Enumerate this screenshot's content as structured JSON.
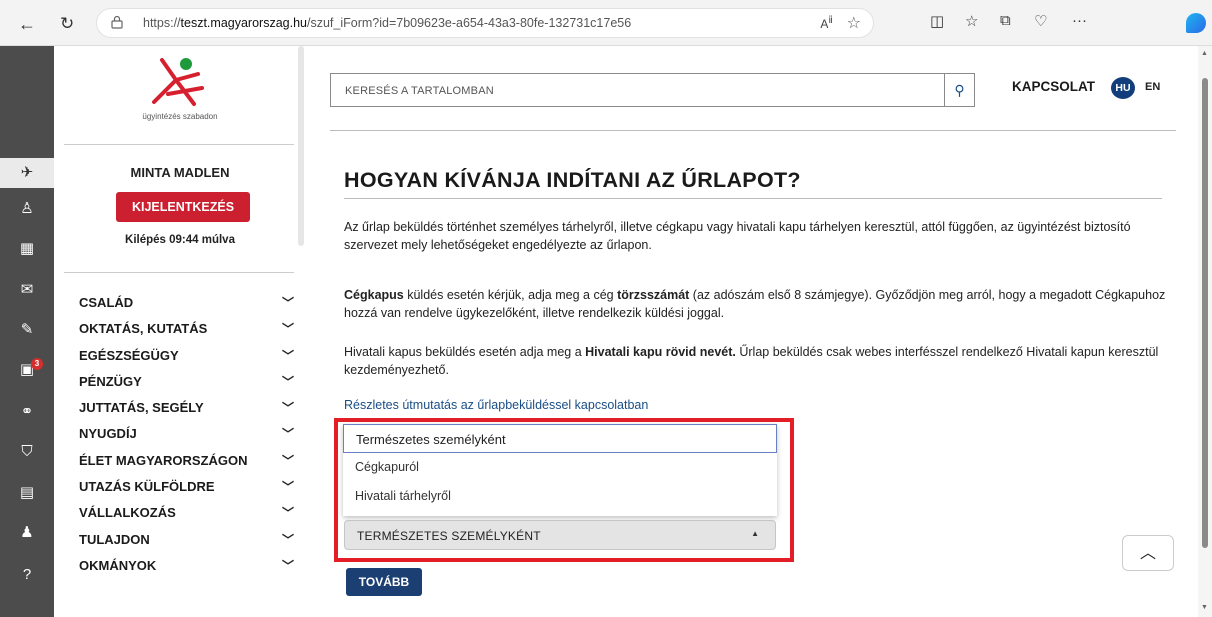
{
  "browser": {
    "url_prefix": "https://",
    "url_host": "teszt.magyarorszag.hu",
    "url_path": "/szuf_iForm?id=7b09623e-a654-43a3-80fe-132731c17e56",
    "back_icon": "back-arrow-icon",
    "reload_icon": "reload-icon"
  },
  "sidebar": {
    "logo_text": "ügyintézés szabadon",
    "user_name": "MINTA MADLEN",
    "logout_label": "KIJELENTKEZÉS",
    "timer_text": "Kilépés 09:44 múlva",
    "menu": [
      {
        "label": "CSALÁD"
      },
      {
        "label": "OKTATÁS, KUTATÁS"
      },
      {
        "label": "EGÉSZSÉGÜGY"
      },
      {
        "label": "PÉNZÜGY"
      },
      {
        "label": "JUTTATÁS, SEGÉLY"
      },
      {
        "label": "NYUGDÍJ"
      },
      {
        "label": "ÉLET MAGYARORSZÁGON"
      },
      {
        "label": "UTAZÁS KÜLFÖLDRE"
      },
      {
        "label": "VÁLLALKOZÁS"
      },
      {
        "label": "TULAJDON"
      },
      {
        "label": "OKMÁNYOK"
      }
    ]
  },
  "icon_strip": {
    "notification_count": "3"
  },
  "header": {
    "search_placeholder": "KERESÉS A TARTALOMBAN",
    "contact_label": "KAPCSOLAT",
    "lang_hu": "HU",
    "lang_en": "EN"
  },
  "main": {
    "title": "HOGYAN KÍVÁNJA INDÍTANI AZ ŰRLAPOT?",
    "para1": "Az űrlap beküldés történhet személyes tárhelyről, illetve cégkapu vagy hivatali kapu tárhelyen keresztül, attól függően, az ügyintézést biztosító szervezet mely lehetőségeket engedélyezte az űrlapon.",
    "para2_bold1": "Cégkapus",
    "para2_text1": " küldés esetén kérjük, adja meg a cég ",
    "para2_bold2": "törzsszámát",
    "para2_text2": " (az adószám első 8 számjegye). Győződjön meg arról, hogy a megadott Cégkapuhoz hozzá van rendelve ügykezelőként, illetve rendelkezik küldési joggal.",
    "para3_text1": "Hivatali kapus beküldés esetén adja meg a ",
    "para3_bold": "Hivatali kapu rövid nevét.",
    "para3_text2": " Űrlap beküldés csak webes interfésszel rendelkező Hivatali kapun keresztül kezdeményezhető.",
    "link_text": "Részletes útmutatás az űrlapbeküldéssel kapcsolatban",
    "dropdown_options": [
      "Természetes személyként",
      "Cégkapuról",
      "Hivatali tárhelyről"
    ],
    "dropdown_selected": "TERMÉSZETES SZEMÉLYKÉNT",
    "next_label": "TOVÁBB",
    "highlight_color": "#e31e26"
  },
  "colors": {
    "logout_red": "#cc1f2f",
    "brand_blue": "#1b3e73",
    "link_blue": "#1a4f86"
  }
}
